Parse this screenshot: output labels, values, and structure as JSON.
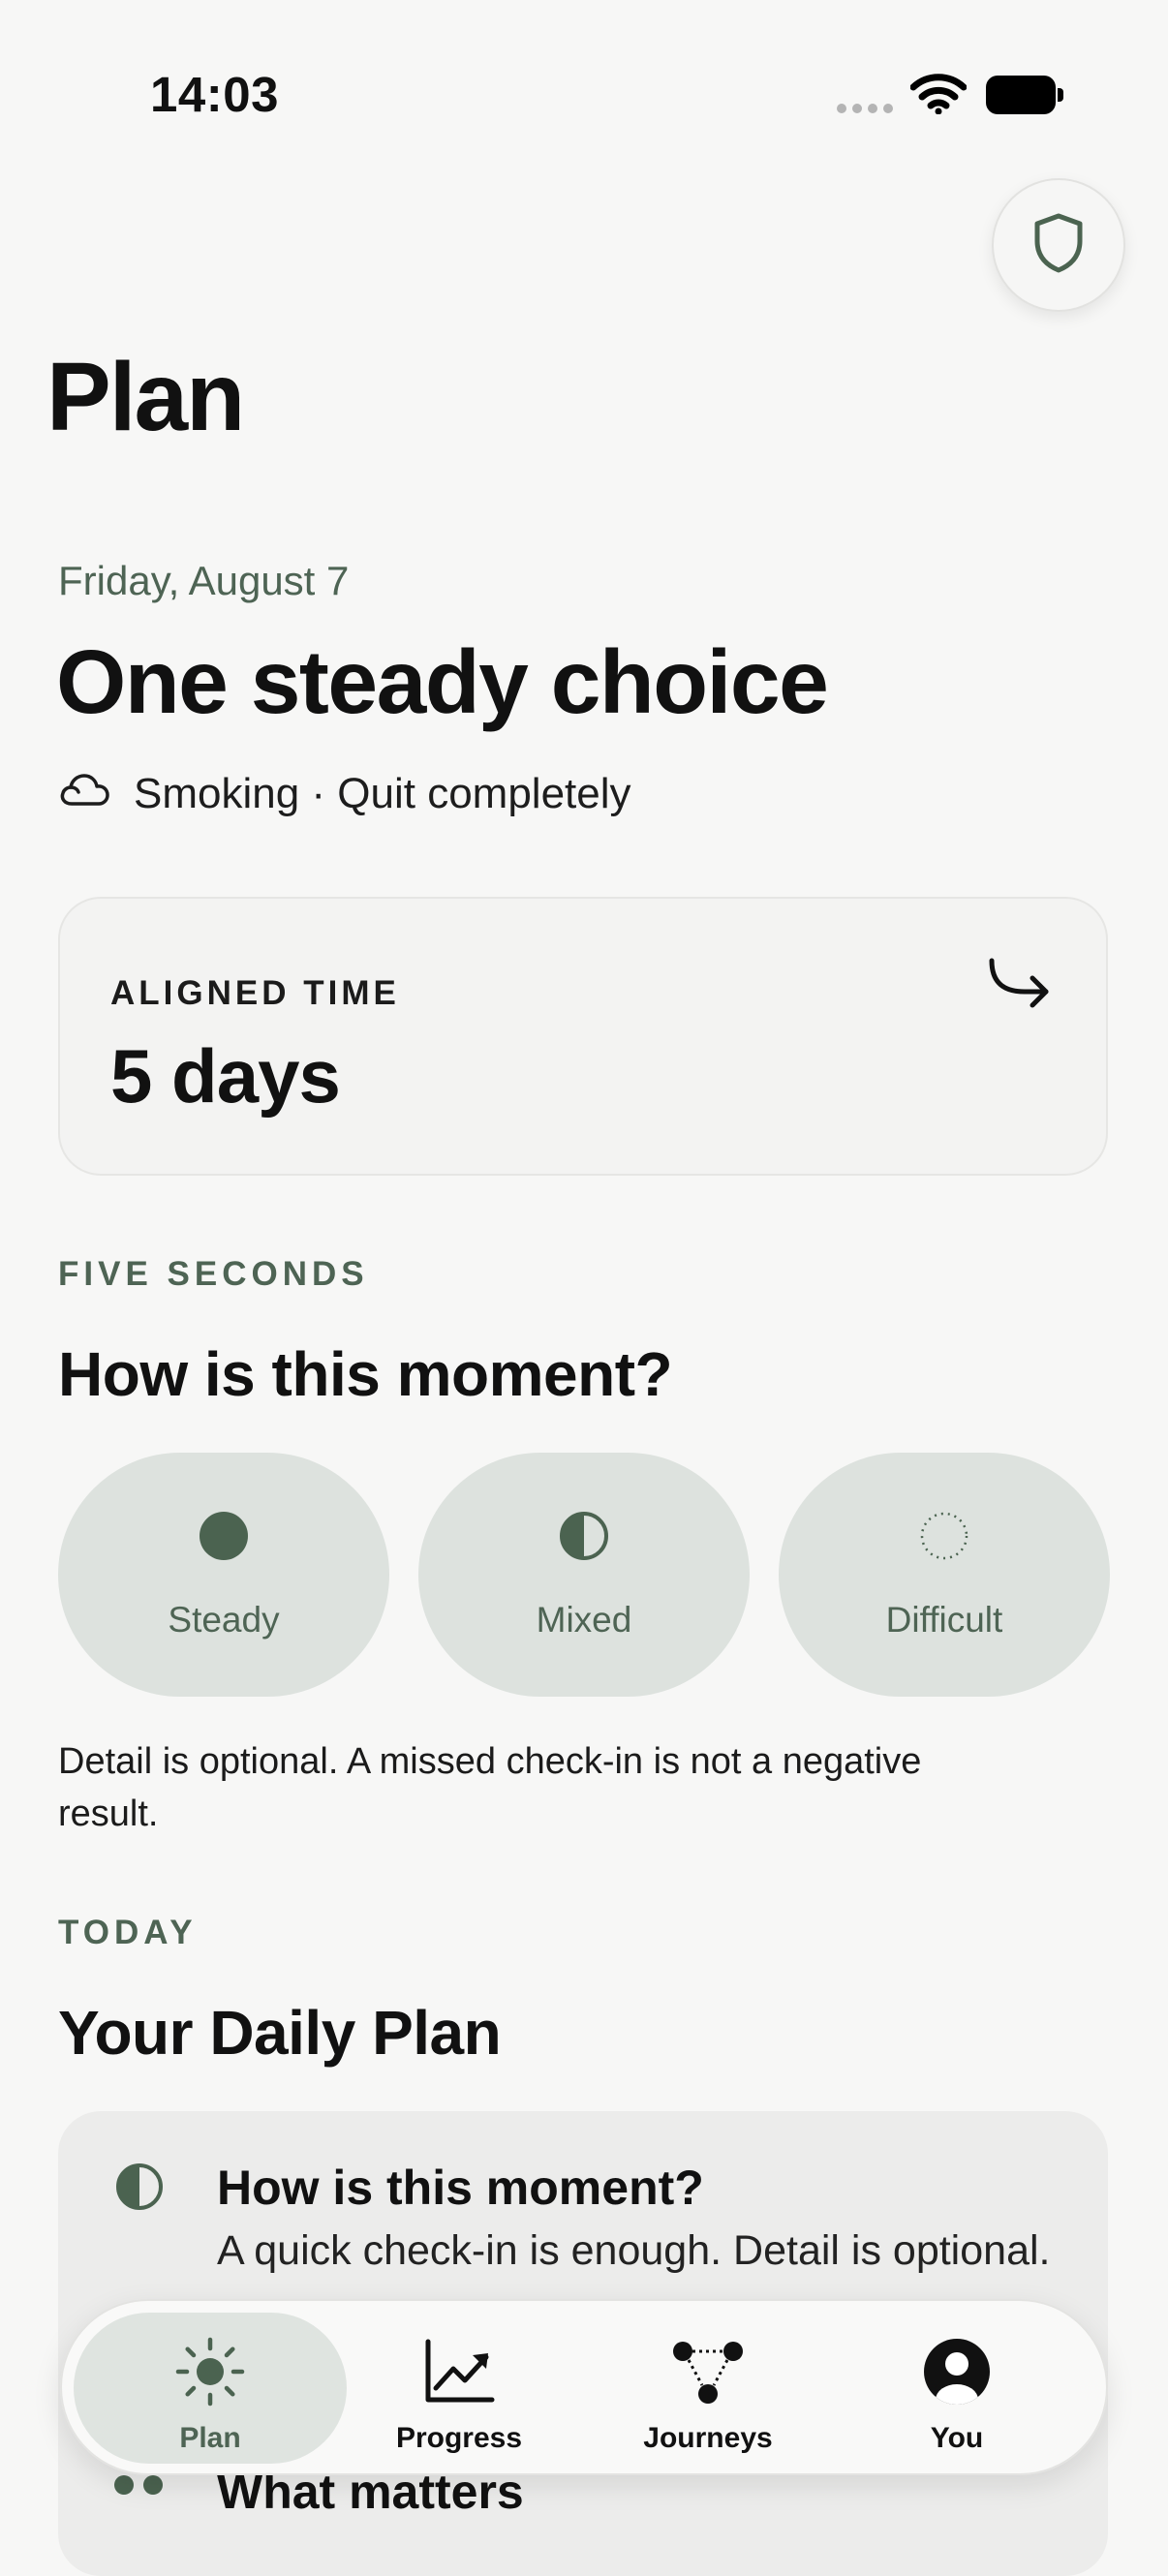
{
  "status_bar": {
    "time": "14:03"
  },
  "header": {
    "title": "Plan"
  },
  "today": {
    "date": "Friday, August 7",
    "headline": "One steady choice",
    "habit": "Smoking · Quit completely"
  },
  "aligned": {
    "label": "ALIGNED TIME",
    "value": "5 days"
  },
  "checkin": {
    "section_label": "FIVE SECONDS",
    "heading": "How is this moment?",
    "options": [
      {
        "label": "Steady",
        "icon": "filled-circle-icon"
      },
      {
        "label": "Mixed",
        "icon": "half-circle-icon"
      },
      {
        "label": "Difficult",
        "icon": "dotted-circle-icon"
      }
    ],
    "note": "Detail is optional. A missed check-in is not a negative result."
  },
  "daily_plan": {
    "section_label": "TODAY",
    "heading": "Your Daily Plan",
    "items": [
      {
        "title": "How is this moment?",
        "subtitle": "A quick check-in is enough. Detail is optional."
      },
      {
        "title": "What matters",
        "subtitle": ""
      }
    ]
  },
  "tabbar": {
    "tabs": [
      {
        "label": "Plan",
        "icon": "sun-icon",
        "active": true
      },
      {
        "label": "Progress",
        "icon": "chart-icon",
        "active": false
      },
      {
        "label": "Journeys",
        "icon": "journeys-icon",
        "active": false
      },
      {
        "label": "You",
        "icon": "person-icon",
        "active": false
      }
    ]
  },
  "colors": {
    "accent": "#4e6454",
    "pill": "#dde2de",
    "background": "#f7f7f6"
  }
}
